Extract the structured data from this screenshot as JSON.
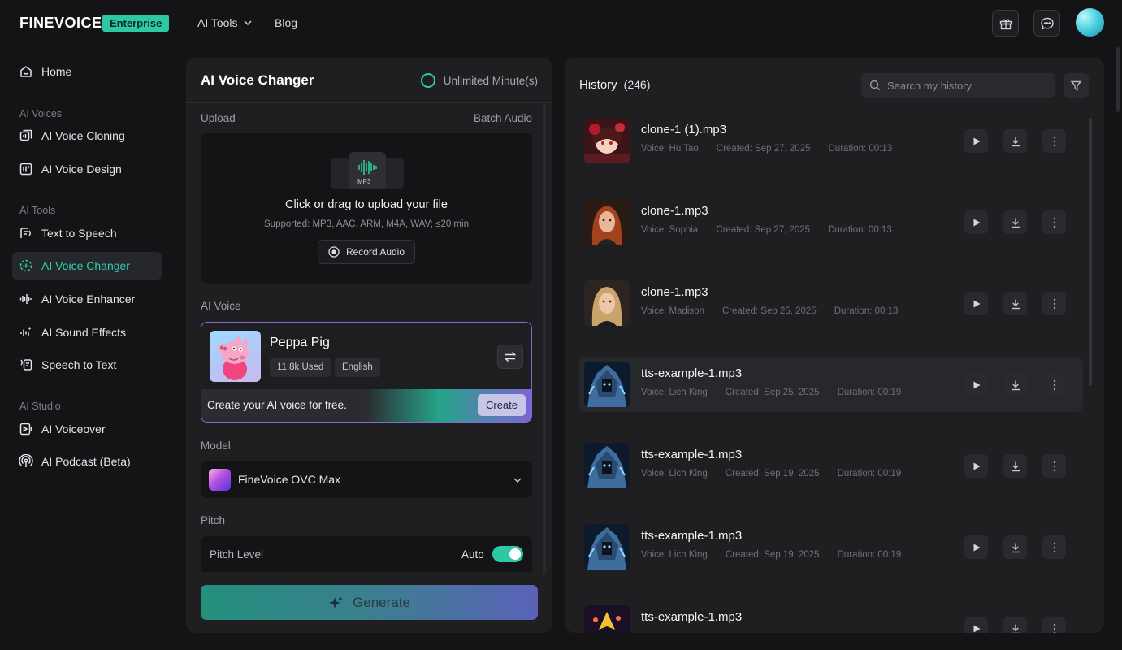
{
  "header": {
    "logo": "FINEVOICE",
    "badge": "Enterprise",
    "nav": [
      {
        "label": "AI Tools"
      },
      {
        "label": "Blog"
      }
    ],
    "icons": [
      "gift-icon",
      "chat-icon",
      "avatar"
    ]
  },
  "sidebar": {
    "home": "Home",
    "sections": [
      {
        "title": "AI Voices",
        "items": [
          "AI Voice Cloning",
          "AI Voice Design"
        ]
      },
      {
        "title": "AI Tools",
        "items": [
          "Text to Speech",
          "AI Voice Changer",
          "AI Voice Enhancer",
          "AI Sound Effects",
          "Speech to Text"
        ]
      },
      {
        "title": "AI Studio",
        "items": [
          "AI Voiceover",
          "AI Podcast (Beta)"
        ]
      }
    ],
    "active": "AI Voice Changer"
  },
  "changer": {
    "title": "AI Voice Changer",
    "unlimited": "Unlimited Minute(s)",
    "upload_label": "Upload",
    "batch_label": "Batch Audio",
    "upload_file_tag": "MP3",
    "upload_main": "Click or drag to upload your file",
    "upload_sub": "Supported: MP3, AAC, ARM, M4A, WAV; ≤20 min",
    "record_label": "Record Audio",
    "voice_label": "AI Voice",
    "voice": {
      "name": "Peppa Pig",
      "tags": [
        "11.8k Used",
        "English"
      ],
      "promo": "Create your AI voice for free.",
      "create_label": "Create"
    },
    "model_label": "Model",
    "model_value": "FineVoice OVC Max",
    "pitch_label": "Pitch",
    "pitch_level_label": "Pitch Level",
    "pitch_mode": "Auto",
    "pitch_auto_on": true,
    "generate_label": "Generate"
  },
  "history": {
    "title": "History",
    "count": "(246)",
    "search_placeholder": "Search my history",
    "items": [
      {
        "name": "clone-1 (1).mp3",
        "voice": "Voice: Hu Tao",
        "created": "Created: Sep 27, 2025",
        "duration": "Duration: 00:13",
        "thumb": "anime"
      },
      {
        "name": "clone-1.mp3",
        "voice": "Voice: Sophia",
        "created": "Created: Sep 27, 2025",
        "duration": "Duration: 00:13",
        "thumb": "redhair"
      },
      {
        "name": "clone-1.mp3",
        "voice": "Voice: Madison",
        "created": "Created: Sep 25, 2025",
        "duration": "Duration: 00:13",
        "thumb": "blonde"
      },
      {
        "name": "tts-example-1.mp3",
        "voice": "Voice: Lich King",
        "created": "Created: Sep 25, 2025",
        "duration": "Duration: 00:19",
        "thumb": "lich"
      },
      {
        "name": "tts-example-1.mp3",
        "voice": "Voice: Lich King",
        "created": "Created: Sep 19, 2025",
        "duration": "Duration: 00:19",
        "thumb": "lich"
      },
      {
        "name": "tts-example-1.mp3",
        "voice": "Voice: Lich King",
        "created": "Created: Sep 19, 2025",
        "duration": "Duration: 00:19",
        "thumb": "lich"
      },
      {
        "name": "tts-example-1.mp3",
        "voice": "",
        "created": "",
        "duration": "",
        "thumb": "fire"
      }
    ],
    "highlighted_index": 3
  }
}
